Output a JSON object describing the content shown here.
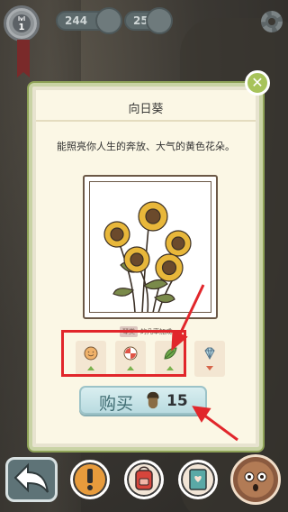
{
  "hud": {
    "level": "1",
    "clover_count": "244",
    "acorn_count": "25"
  },
  "dialog": {
    "title": "向日葵",
    "description": "能照亮你人生的奔放、大气的黄色花朵。",
    "tag": "琴类",
    "tag_suffix": "的几率加成",
    "close_label": "✕"
  },
  "bonuses": [
    {
      "icon": "smiley-icon",
      "direction": "up"
    },
    {
      "icon": "ball-icon",
      "direction": "up"
    },
    {
      "icon": "leaf-icon",
      "direction": "up"
    },
    {
      "icon": "diamond-icon",
      "direction": "down"
    }
  ],
  "buy": {
    "label": "购买",
    "price": "15"
  },
  "colors": {
    "accent_green": "#a7c35a",
    "annotation_red": "#e1262b",
    "buy_bg": "#c7e5e9"
  }
}
